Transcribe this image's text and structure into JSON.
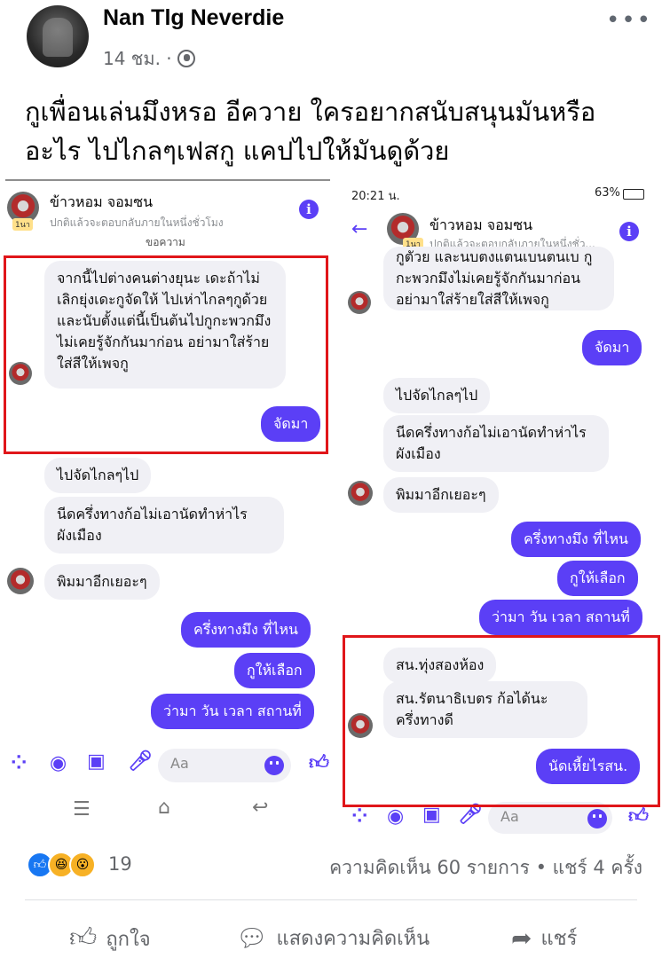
{
  "post": {
    "author": "Nan Tlg Neverdie",
    "time": "14 ชม. ·",
    "text": "กูเพื่อนเล่นมึงหรอ อีควาย ใครอยากสนับสนุนมันหรืออะไร ไปไกลๆเฟสกู แคปไปให้มันดูด้วย",
    "more_label": "•••"
  },
  "left": {
    "contact": "ข้าวหอม จอมซน",
    "status": "ปกติแล้วจะตอบกลับภายในหนึ่งชั่วโมง",
    "badge": "1นา",
    "section_label": "ขอความ",
    "msg1": "จากนี้ไปต่างคนต่างยุนะ เดะถ้าไม่เลิกยุ่งเดะกูจัดให้ ไปเห่าไกลๆกูด้วย และนับตั้งแต่นี้เป็นต้นไปกูกะพวกมึงไม่เคยรู้จักกันมาก่อน อย่ามาใส่ร้ายใส่สีให้เพจกู",
    "out1": "จัดมา",
    "msg2": "ไปจัดไกลๆไป",
    "msg3": "นีดครึ่งทางก้อไม่เอานัดทำห่าไรผังเมือง",
    "msg4": "พิมมาอีกเยอะๆ",
    "out2": "ครึ่งทางมึง ที่ไหน",
    "out3": "กูให้เลือก",
    "out4": "ว่ามา วัน เวลา สถานที่",
    "composer_placeholder": "Aa"
  },
  "right": {
    "status_time": "20:21 น.",
    "status_battery": "63%",
    "contact": "ข้าวหอม จอมซน",
    "status": "ปกติแล้วจะตอบกลับภายในหนึ่งชั่ว...",
    "badge": "1นา",
    "msg0": "กูตัวย และนบตงแตนเบนตนเบ กูกะพวกมึงไม่เคยรู้จักกันมาก่อน อย่ามาใส่ร้ายใส่สีให้เพจกู",
    "out1": "จัดมา",
    "msg2": "ไปจัดไกลๆไป",
    "msg3": "นีดครึ่งทางก้อไม่เอานัดทำห่าไร ผังเมือง",
    "msg4": "พิมมาอีกเยอะๆ",
    "out2": "ครึ่งทางมึง ที่ไหน",
    "out3": "กูให้เลือก",
    "out4": "ว่ามา วัน เวลา สถานที่",
    "msg5": "สน.ทุ่งสองห้อง",
    "msg6": "สน.รัตนาธิเบตร ก้อได้นะ ครึ่งทางดี",
    "out5": "นัดเหี้ยไรสน.",
    "composer_placeholder": "Aa"
  },
  "footer": {
    "reaction_count": "19",
    "stats": "ความคิดเห็น 60 รายการ • แชร์ 4 ครั้ง",
    "like_label": "ถูกใจ",
    "comment_label": "แสดงความคิดเห็น",
    "share_label": "แชร์"
  },
  "colors": {
    "messenger_accent": "#5b3ff6",
    "highlight_border": "#e0161a",
    "facebook_blue": "#1877f2"
  }
}
